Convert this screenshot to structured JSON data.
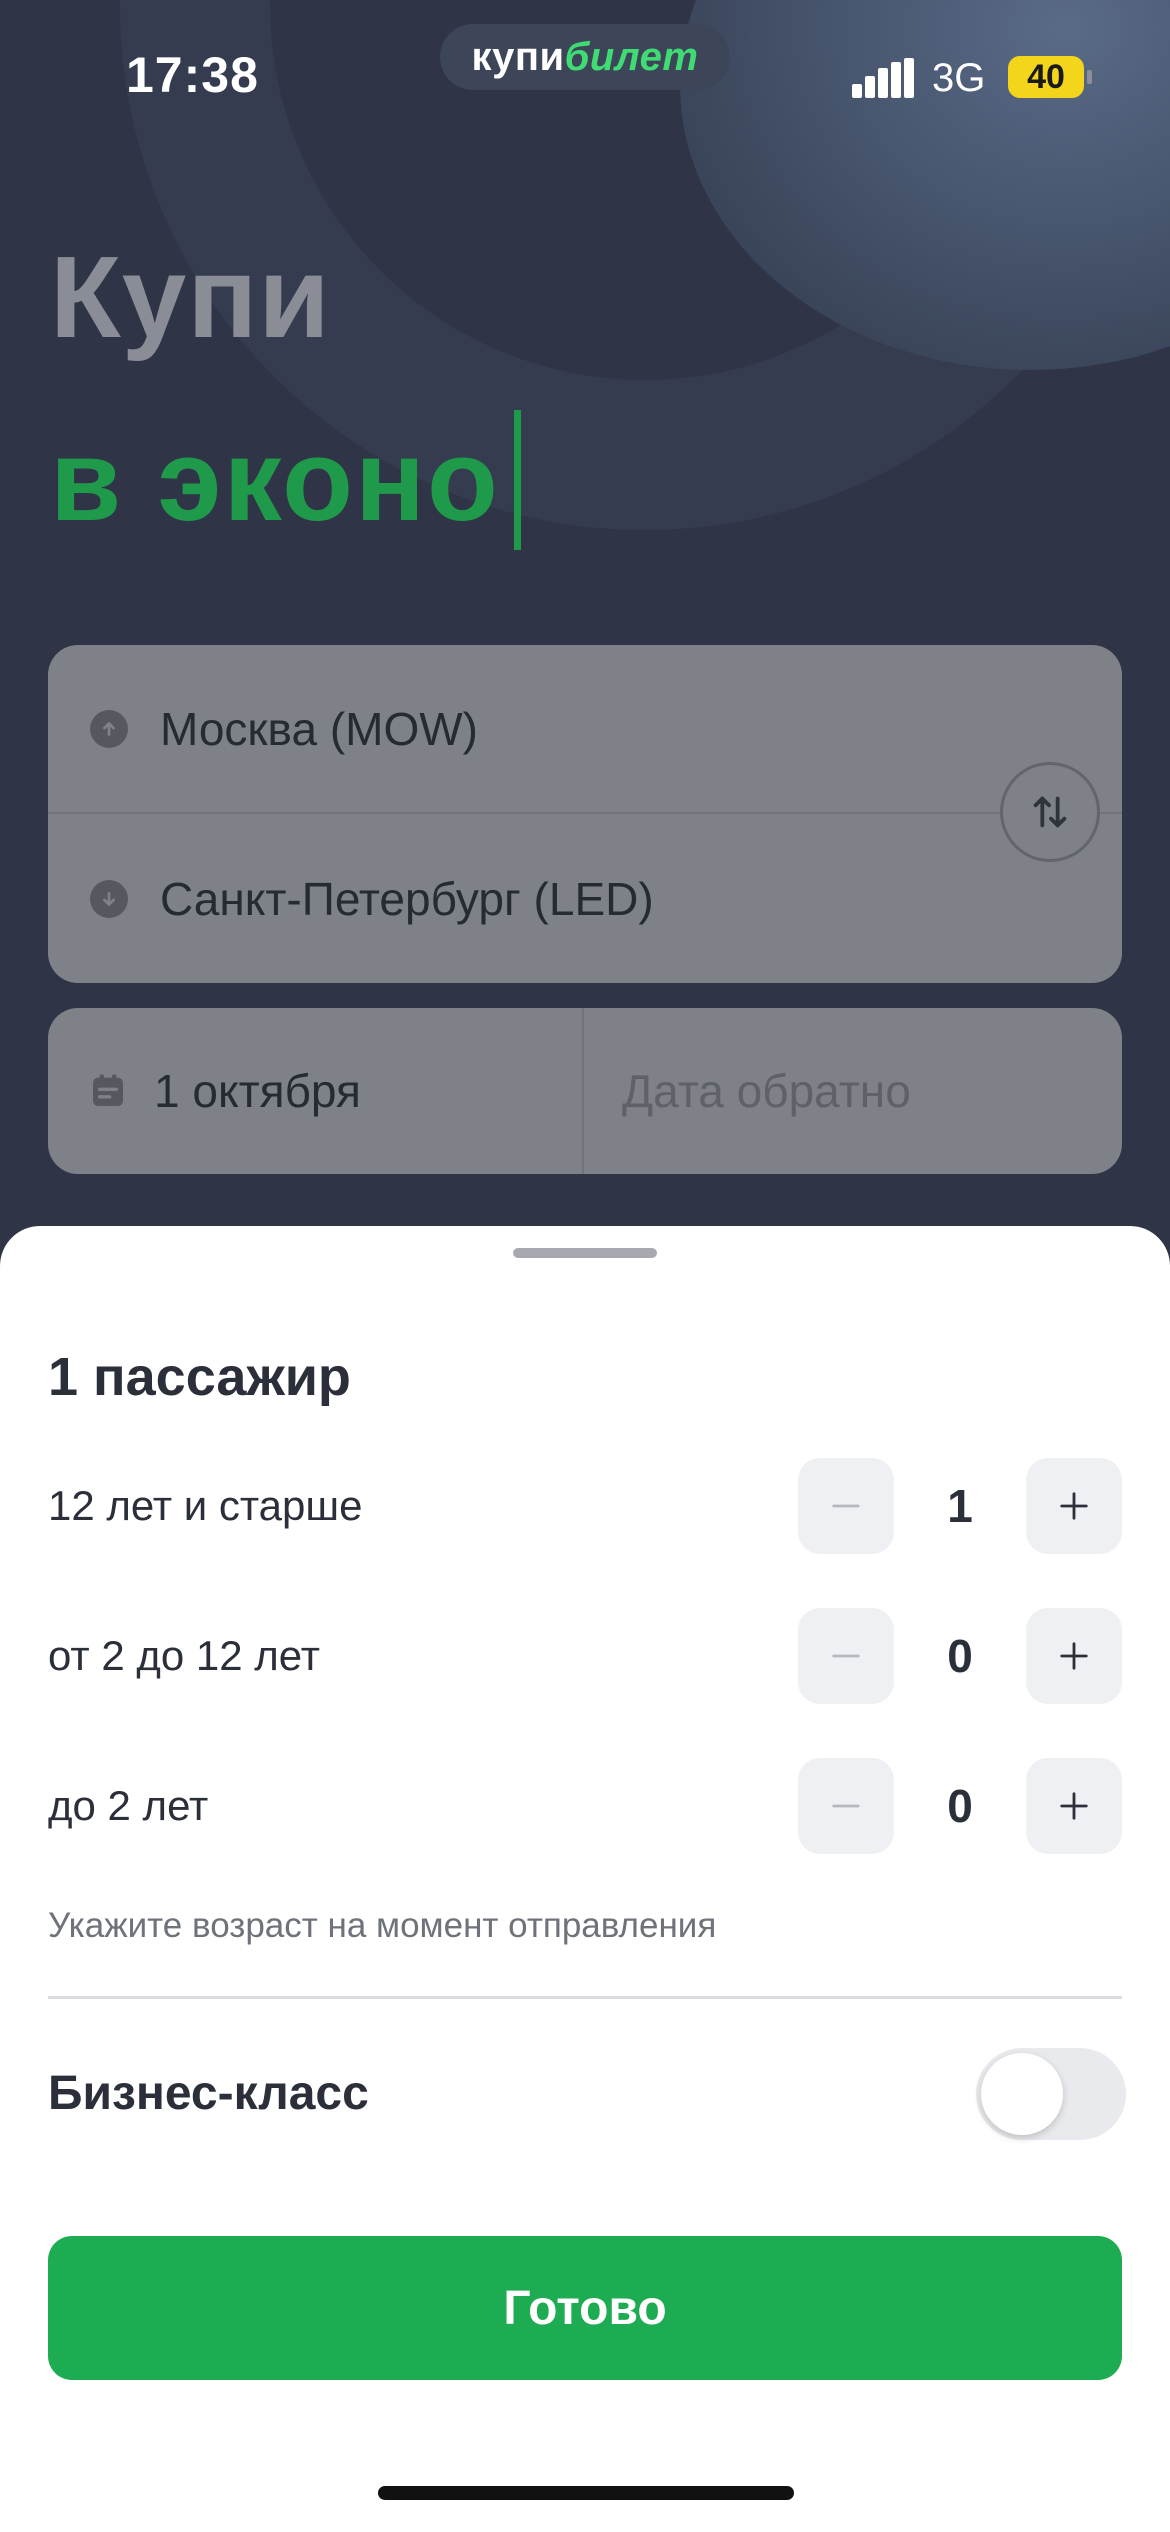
{
  "status_bar": {
    "time": "17:38",
    "brand_part1": "купи",
    "brand_part2": "билет",
    "network": "3G",
    "battery": "40"
  },
  "hero": {
    "line1": "Купи",
    "line2": "в эконо"
  },
  "search": {
    "from": "Москва (MOW)",
    "to": "Санкт-Петербург (LED)",
    "depart_date": "1 октября",
    "return_placeholder": "Дата обратно"
  },
  "sheet": {
    "title": "1 пассажир",
    "passengers": [
      {
        "label": "12 лет и старше",
        "value": "1"
      },
      {
        "label": "от 2 до 12 лет",
        "value": "0"
      },
      {
        "label": "до 2 лет",
        "value": "0"
      }
    ],
    "hint": "Укажите возраст на момент отправления",
    "business_label": "Бизнес-класс",
    "business_enabled": false,
    "done_label": "Готово"
  },
  "colors": {
    "accent": "#1dac52",
    "headline_green": "#1f9a4a",
    "background_dark": "#2f3547"
  }
}
